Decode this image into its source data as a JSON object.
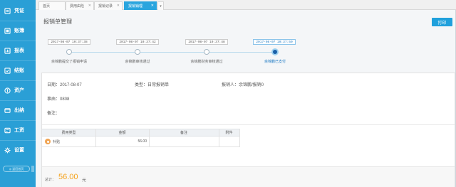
{
  "sidebar": {
    "items": [
      {
        "label": "凭证",
        "icon": "voucher-icon"
      },
      {
        "label": "账簿",
        "icon": "ledger-icon"
      },
      {
        "label": "报表",
        "icon": "report-icon"
      },
      {
        "label": "结账",
        "icon": "check-icon"
      },
      {
        "label": "资产",
        "icon": "assets-icon"
      },
      {
        "label": "出纳",
        "icon": "cashier-icon"
      },
      {
        "label": "工资",
        "icon": "salary-icon"
      },
      {
        "label": "设置",
        "icon": "gear-icon"
      }
    ],
    "pill": "◎ 返回首页"
  },
  "tabs": [
    {
      "label": "首页"
    },
    {
      "label": "费用由险"
    },
    {
      "label": "报销记录"
    },
    {
      "label": "报销销理"
    }
  ],
  "header": {
    "title": "报销单管理",
    "print_label": "打印"
  },
  "steps": [
    {
      "time": "2017-08-07 10:37:38",
      "label": "余锦鹏提交了报销申请"
    },
    {
      "time": "2017-08-07 10:37:42",
      "label": "余锦鹏审核通过"
    },
    {
      "time": "2017-08-07 10:37:48",
      "label": "余锦鹏财务审核通过"
    },
    {
      "time": "2017-08-07 10:37:50",
      "label": "余锦鹏已支付"
    }
  ],
  "detail": {
    "date_label": "日期：",
    "date_value": "2017-08-07",
    "type_label": "类型：",
    "type_value": "日常报销单",
    "person_label": "报销人：",
    "person_value": "余锦鹏/报销0",
    "reason_label": "事由：",
    "reason_value": "0808",
    "note_label": "备注："
  },
  "table": {
    "headers": [
      "费用类型",
      "金额",
      "备注",
      "附件"
    ],
    "rows": [
      {
        "type": "补贴",
        "amount": "56.00",
        "note": "",
        "attachment": ""
      }
    ]
  },
  "total": {
    "label": "总计：",
    "amount": "56.00",
    "unit": "元"
  },
  "colors": {
    "sidebar": "#2a9fd6",
    "accent": "#1fa0dc",
    "total": "#f5a21b"
  }
}
